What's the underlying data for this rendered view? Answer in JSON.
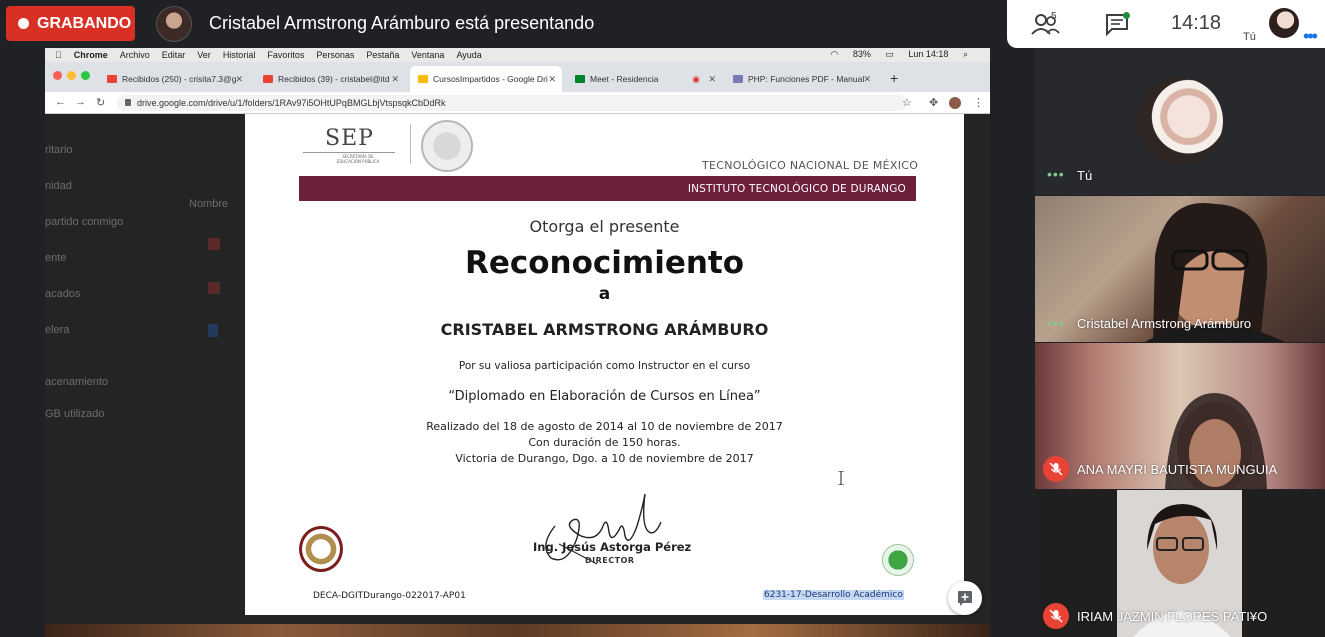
{
  "meet": {
    "recording_label": "GRABANDO",
    "presenting_text": "Cristabel Armstrong Arámburo está presentando",
    "participants_count": "5",
    "clock": "14:18",
    "self_short_label": "Tú"
  },
  "mac_menu": {
    "items": [
      "Chrome",
      "Archivo",
      "Editar",
      "Ver",
      "Historial",
      "Favoritos",
      "Personas",
      "Pestaña",
      "Ventana",
      "Ayuda"
    ],
    "battery": "83%",
    "datetime": "Lun 14:18"
  },
  "browser": {
    "tabs": [
      {
        "label": "Recibidos (250) - crisita7.3@g",
        "icon": "gmail-icon",
        "active": false
      },
      {
        "label": "Recibidos (39) - cristabel@itd",
        "icon": "gmail-icon",
        "active": false
      },
      {
        "label": "CursosImpartidos - Google Dri",
        "icon": "drive-icon",
        "active": true
      },
      {
        "label": "Meet - Residencia",
        "icon": "meet-icon",
        "active": false
      },
      {
        "label": "PHP: Funciones PDF - Manual",
        "icon": "php-icon",
        "active": false
      }
    ],
    "url": "drive.google.com/drive/u/1/folders/1RAv97i5OHtUPqBMGLbjVtspsqkCbDdRk"
  },
  "drive_sidebar": {
    "items": [
      "ritario",
      "nidad",
      "partido conmigo",
      "ente",
      "acados",
      "elera",
      "acenamiento",
      "GB utilizado"
    ],
    "list_header": "Nombre"
  },
  "certificate": {
    "agency": "SEP",
    "agency_sub": "SECRETARÍA DE EDUCACIÓN PÚBLICA",
    "network": "TECNOLÓGICO NACIONAL DE MÉXICO",
    "institute": "INSTITUTO TECNOLÓGICO DE DURANGO",
    "otorga": "Otorga el presente",
    "title": "Reconocimiento",
    "a": "a",
    "recipient": "CRISTABEL ARMSTRONG ARÁMBURO",
    "reason": "Por su valiosa participación como Instructor en el curso",
    "course": "“Diplomado en Elaboración de Cursos en Línea”",
    "dates": "Realizado del 18 de agosto de 2014 al 10 de noviembre de 2017",
    "duration": "Con duración de 150 horas.",
    "place_date": "Victoria de Durango, Dgo. a 10 de noviembre de 2017",
    "signer": "Ing. Jesús Astorga Pérez",
    "signer_role": "DIRECTOR",
    "code_left": "DECA-DGITDurango-022017-AP01",
    "code_right": "6231-17-Desarrollo Académico"
  },
  "participants": [
    {
      "name": "Tú",
      "state": "speaking"
    },
    {
      "name": "Cristabel Armstrong Arámburo",
      "state": "speaking"
    },
    {
      "name": "ANA MAYRI BAUTISTA MUNGUIA",
      "state": "muted"
    },
    {
      "name": "IRIAM JAZMIN FLORES PATI¥O",
      "state": "muted"
    }
  ],
  "colors": {
    "recording_red": "#d93025",
    "itd_maroon": "#6e1f3c",
    "meet_green": "#1e8e3e",
    "mic_off_red": "#ea4335"
  }
}
